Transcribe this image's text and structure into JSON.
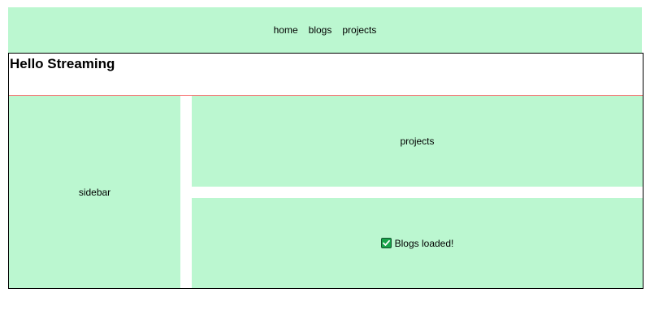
{
  "nav": {
    "items": [
      {
        "label": "home"
      },
      {
        "label": "blogs"
      },
      {
        "label": "projects"
      }
    ]
  },
  "header": {
    "title": "Hello Streaming"
  },
  "sidebar": {
    "label": "sidebar"
  },
  "panels": {
    "projects_label": "projects",
    "blogs_status": "Blogs loaded!",
    "blogs_status_icon": "check-mark-icon"
  },
  "colors": {
    "panel_background": "#bbf7d0",
    "header_border": "#f87171",
    "check_icon": "#16a34a"
  }
}
